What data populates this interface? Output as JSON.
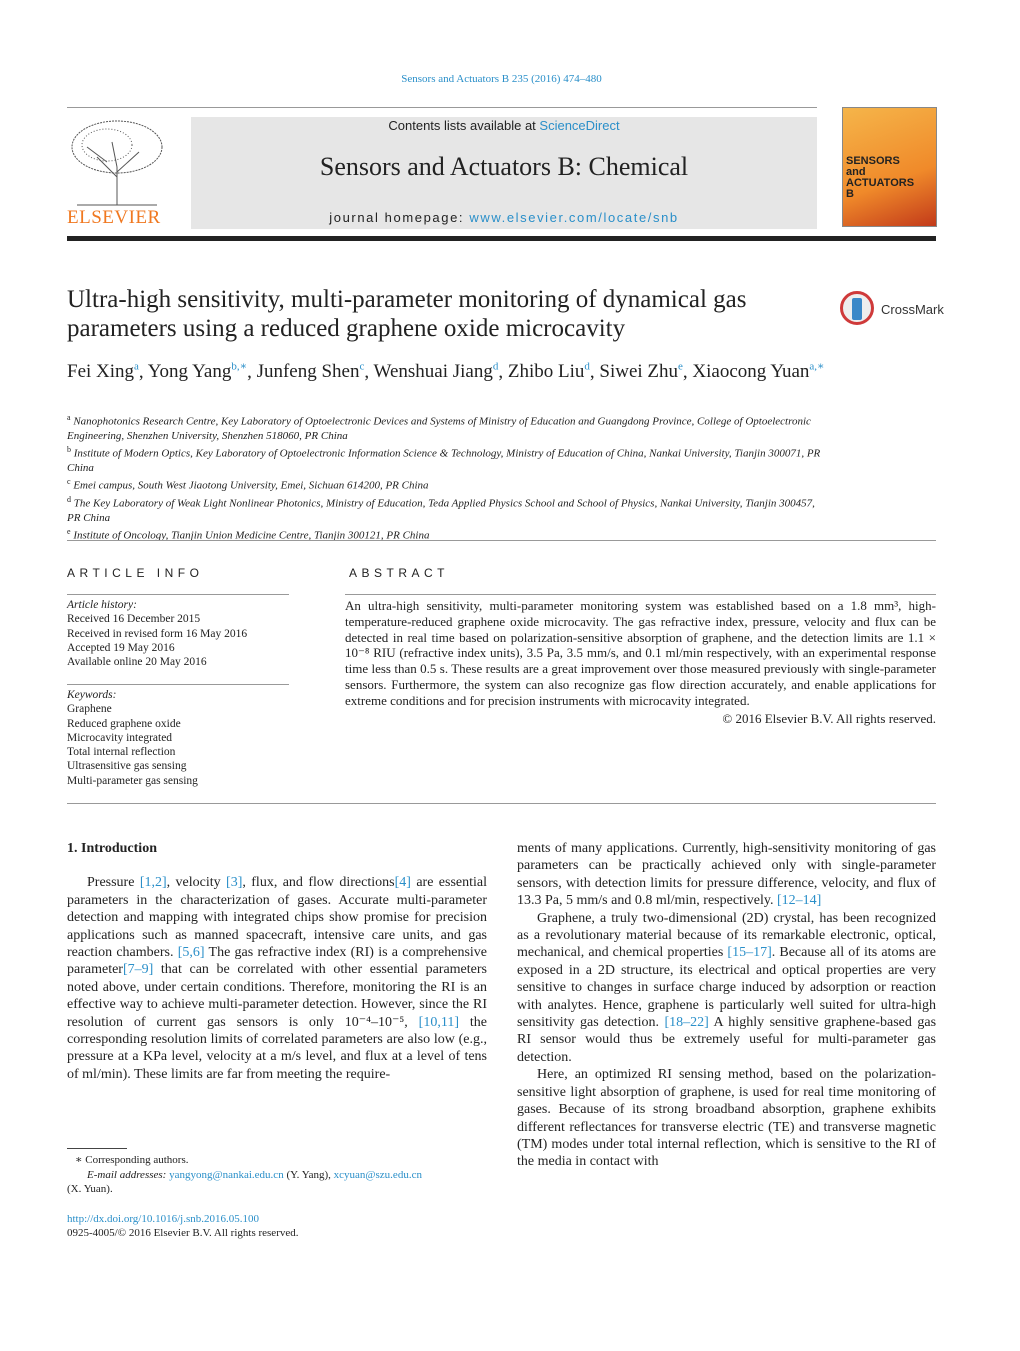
{
  "header": {
    "journal_ref": "Sensors and Actuators B 235 (2016) 474–480",
    "contents_prefix": "Contents lists available at ",
    "contents_link": "ScienceDirect",
    "journal_title": "Sensors and Actuators B: Chemical",
    "homepage_prefix": "journal homepage: ",
    "homepage_link": "www.elsevier.com/locate/snb",
    "publisher": "ELSEVIER",
    "cover_text": "SENSORS and ACTUATORS B",
    "crossmark": "CrossMark"
  },
  "article": {
    "title": "Ultra-high sensitivity, multi-parameter monitoring of dynamical gas parameters using a reduced graphene oxide microcavity",
    "authors": [
      {
        "name": "Fei Xing",
        "sup": "a"
      },
      {
        "name": "Yong Yang",
        "sup": "b,∗"
      },
      {
        "name": "Junfeng Shen",
        "sup": "c"
      },
      {
        "name": "Wenshuai Jiang",
        "sup": "d"
      },
      {
        "name": "Zhibo Liu",
        "sup": "d"
      },
      {
        "name": "Siwei Zhu",
        "sup": "e"
      },
      {
        "name": "Xiaocong Yuan",
        "sup": "a,∗"
      }
    ],
    "affiliations": [
      {
        "sup": "a",
        "text": "Nanophotonics Research Centre, Key Laboratory of Optoelectronic Devices and Systems of Ministry of Education and Guangdong Province, College of Optoelectronic Engineering, Shenzhen University, Shenzhen 518060, PR China"
      },
      {
        "sup": "b",
        "text": "Institute of Modern Optics, Key Laboratory of Optoelectronic Information Science & Technology, Ministry of Education of China, Nankai University, Tianjin 300071, PR China"
      },
      {
        "sup": "c",
        "text": "Emei campus, South West Jiaotong University, Emei, Sichuan 614200, PR China"
      },
      {
        "sup": "d",
        "text": "The Key Laboratory of Weak Light Nonlinear Photonics, Ministry of Education, Teda Applied Physics School and School of Physics, Nankai University, Tianjin 300457, PR China"
      },
      {
        "sup": "e",
        "text": "Institute of Oncology, Tianjin Union Medicine Centre, Tianjin 300121, PR China"
      }
    ]
  },
  "info": {
    "heading": "ARTICLE INFO",
    "history_label": "Article history:",
    "history": [
      "Received 16 December 2015",
      "Received in revised form 16 May 2016",
      "Accepted 19 May 2016",
      "Available online 20 May 2016"
    ],
    "keywords_label": "Keywords:",
    "keywords": [
      "Graphene",
      "Reduced graphene oxide",
      "Microcavity integrated",
      "Total internal reflection",
      "Ultrasensitive gas sensing",
      "Multi-parameter gas sensing"
    ]
  },
  "abstract": {
    "heading": "ABSTRACT",
    "text": "An ultra-high sensitivity, multi-parameter monitoring system was established based on a 1.8 mm³, high-temperature-reduced graphene oxide microcavity. The gas refractive index, pressure, velocity and flux can be detected in real time based on polarization-sensitive absorption of graphene, and the detection limits are 1.1 × 10⁻⁸ RIU (refractive index units), 3.5 Pa, 3.5 mm/s, and 0.1 ml/min respectively, with an experimental response time less than 0.5 s. These results are a great improvement over those measured previously with single-parameter sensors. Furthermore, the system can also recognize gas flow direction accurately, and enable applications for extreme conditions and for precision instruments with microcavity integrated.",
    "copyright": "© 2016 Elsevier B.V. All rights reserved."
  },
  "body": {
    "section_title": "1.  Introduction",
    "left": [
      [
        {
          "t": "Pressure "
        },
        {
          "r": "[1,2]"
        },
        {
          "t": ", velocity "
        },
        {
          "r": "[3]"
        },
        {
          "t": ", flux, and flow directions"
        },
        {
          "r": "[4]"
        },
        {
          "t": " are essential parameters in the characterization of gases. Accurate multi-parameter detection and mapping with integrated chips show promise for precision applications such as manned spacecraft, intensive care units, and gas reaction chambers. "
        },
        {
          "r": "[5,6]"
        },
        {
          "t": " The gas refractive index (RI) is a comprehensive parameter"
        },
        {
          "r": "[7–9]"
        },
        {
          "t": " that can be correlated with other essential parameters noted above, under certain conditions. Therefore, monitoring the RI is an effective way to achieve multi-parameter detection. However, since the RI resolution of current gas sensors is only 10⁻⁴–10⁻⁵, "
        },
        {
          "r": "[10,11]"
        },
        {
          "t": " the corresponding resolution limits of correlated parameters are also low (e.g., pressure at a KPa level, velocity at a m/s level, and flux at a level of tens of ml/min). These limits are far from meeting the require-"
        }
      ]
    ],
    "right": [
      [
        {
          "t": "ments of many applications. Currently, high-sensitivity monitoring of gas parameters can be practically achieved only with single-parameter sensors, with detection limits for pressure difference, velocity, and flux of 13.3 Pa, 5 mm/s and 0.8 ml/min, respectively. "
        },
        {
          "r": "[12–14]"
        }
      ],
      [
        {
          "t": "Graphene, a truly two-dimensional (2D) crystal, has been recognized as a revolutionary material because of its remarkable electronic, optical, mechanical, and chemical properties "
        },
        {
          "r": "[15–17]"
        },
        {
          "t": ". Because all of its atoms are exposed in a 2D structure, its electrical and optical properties are very sensitive to changes in surface charge induced by adsorption or reaction with analytes. Hence, graphene is particularly well suited for ultra-high sensitivity gas detection. "
        },
        {
          "r": "[18–22]"
        },
        {
          "t": " A highly sensitive graphene-based gas RI sensor would thus be extremely useful for multi-parameter gas detection."
        }
      ],
      [
        {
          "t": "Here, an optimized RI sensing method, based on the polarization-sensitive light absorption of graphene, is used for real time monitoring of gases. Because of its strong broadband absorption, graphene exhibits different reflectances for transverse electric (TE) and transverse magnetic (TM) modes under total internal reflection, which is sensitive to the RI of the media in contact with"
        }
      ]
    ]
  },
  "footnotes": {
    "corresponding": "∗  Corresponding authors.",
    "email_label": "E-mail addresses: ",
    "email1": "yangyong@nankai.edu.cn",
    "email1_name": " (Y. Yang), ",
    "email2": "xcyuan@szu.edu.cn",
    "email2_name": "(X. Yuan).",
    "doi": "http://dx.doi.org/10.1016/j.snb.2016.05.100",
    "issn": "0925-4005/© 2016 Elsevier B.V. All rights reserved."
  },
  "colors": {
    "link": "#2a8fc9",
    "elsevier": "#f07820",
    "banner": "#e6e6e6"
  }
}
